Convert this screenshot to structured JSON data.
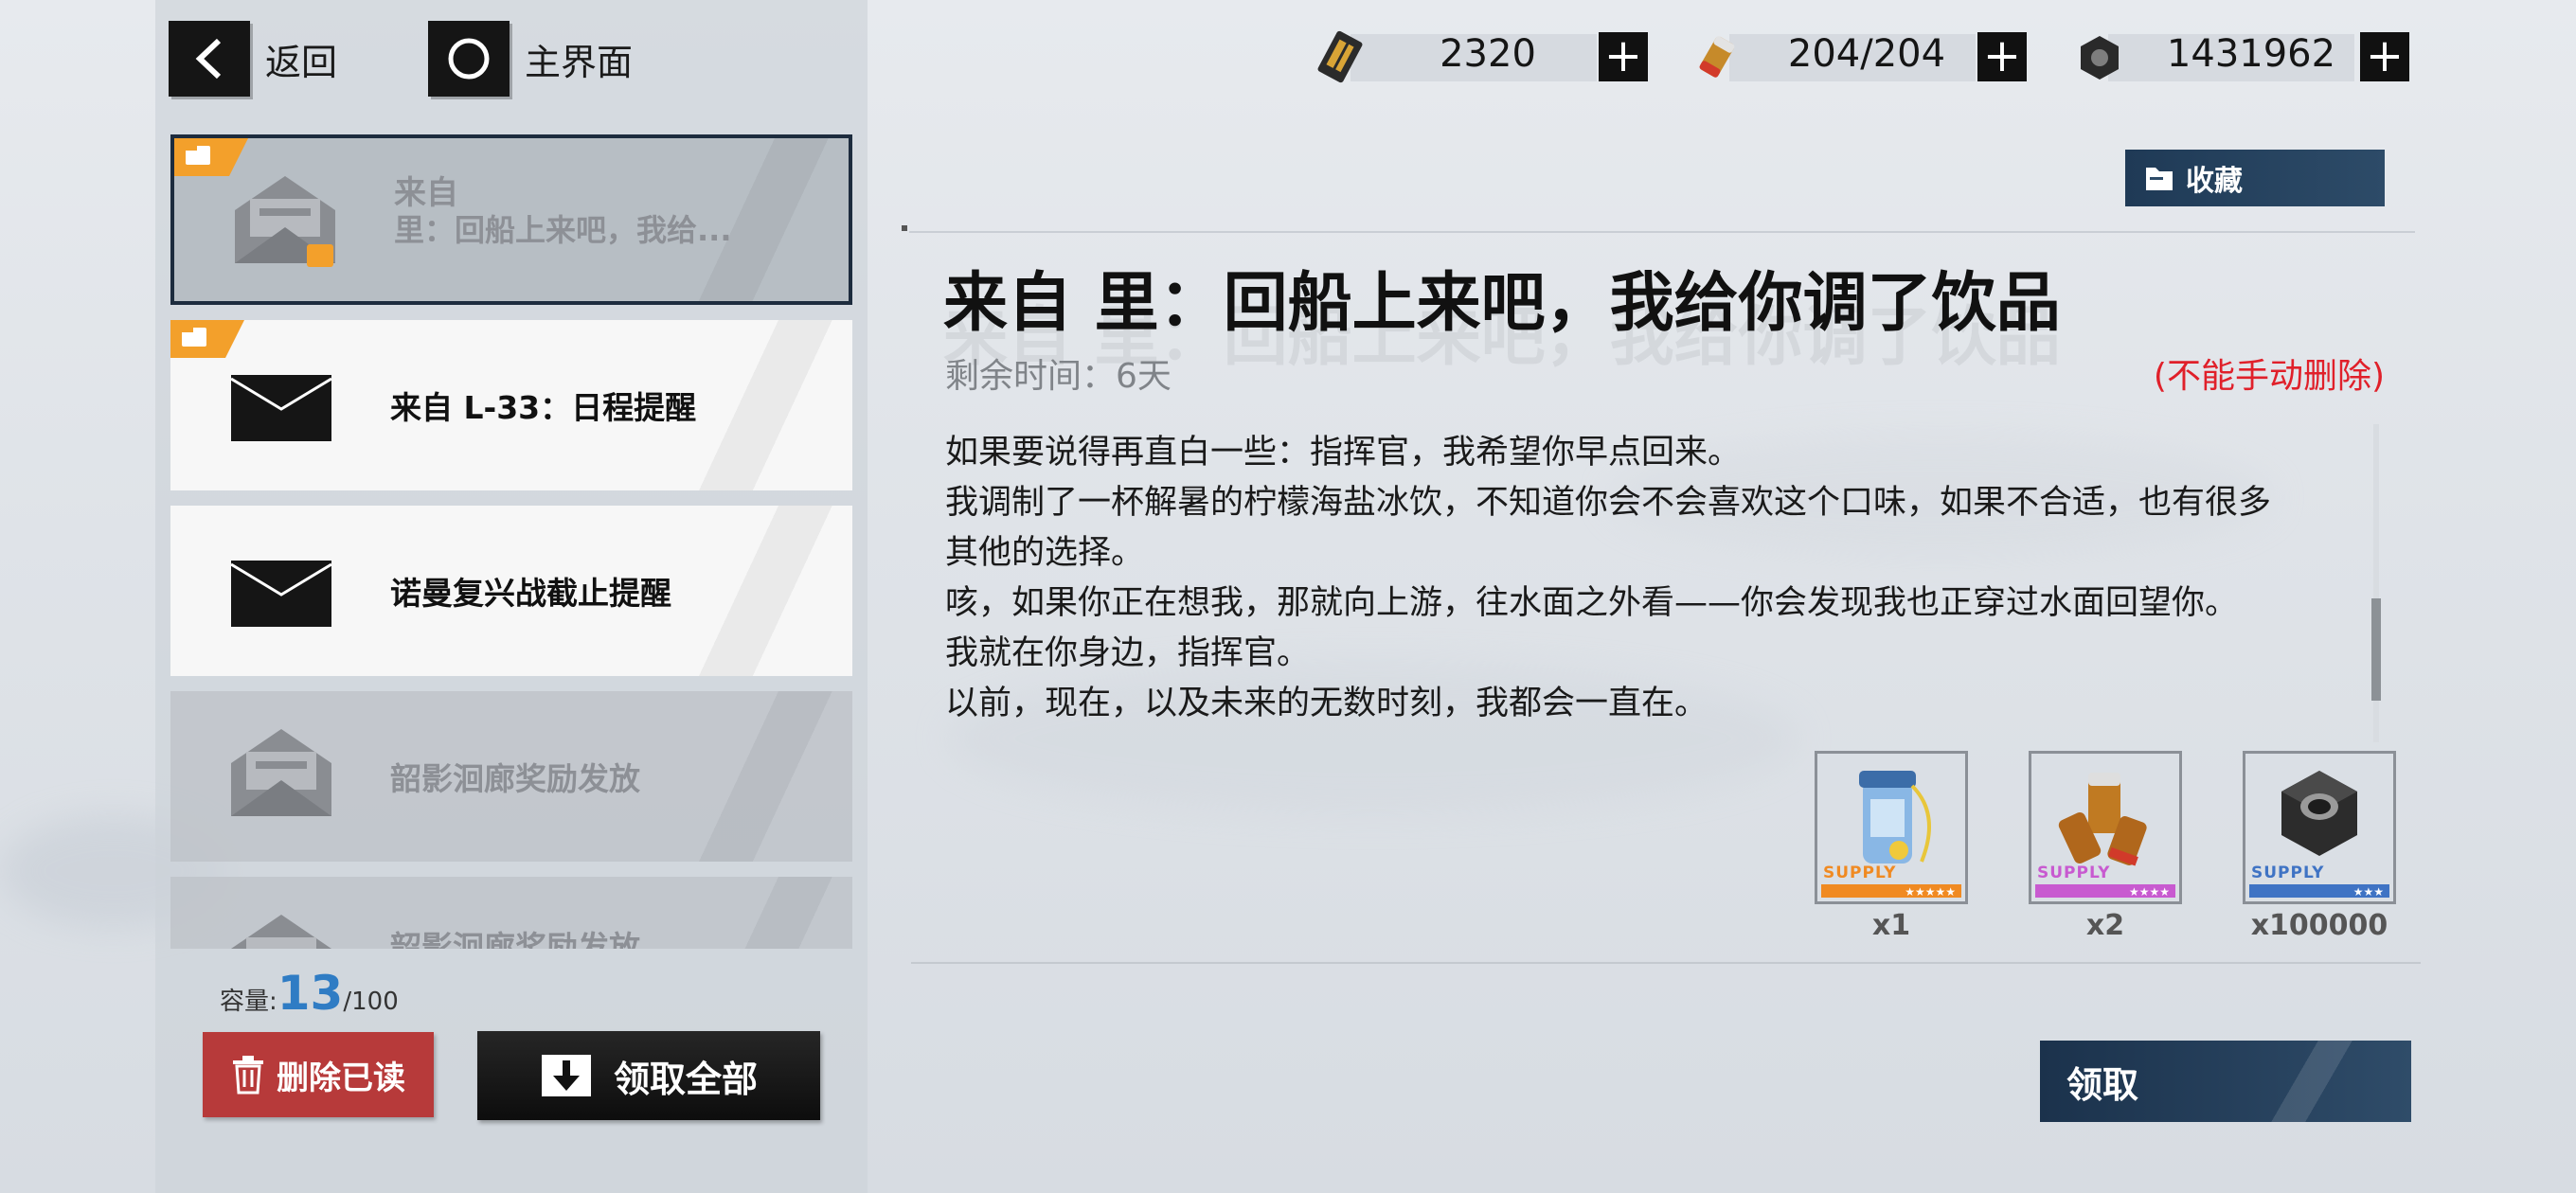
{
  "nav": {
    "back_label": "返回",
    "home_label": "主界面"
  },
  "resources": [
    {
      "icon": "ammo-voucher-icon",
      "value": "2320"
    },
    {
      "icon": "ration-battery-icon",
      "value": "204/204"
    },
    {
      "icon": "hex-nut-icon",
      "value": "1431962"
    }
  ],
  "mail_list": [
    {
      "line1": "来自",
      "line2": "里：回船上来吧，我给...",
      "state": "read",
      "selected": true,
      "flag": true,
      "attachment": true
    },
    {
      "title": "来自 L-33：日程提醒",
      "state": "unread",
      "flag": true
    },
    {
      "title": "诺曼复兴战截止提醒",
      "state": "unread",
      "flag": false
    },
    {
      "title": "韶影洄廊奖励发放",
      "state": "read",
      "flag": false
    },
    {
      "title": "韶影洄廊奖励发放",
      "state": "read",
      "flag": false
    }
  ],
  "capacity": {
    "label": "容量:",
    "current": "13",
    "max": "/100"
  },
  "buttons": {
    "delete_read": "删除已读",
    "collect_all": "领取全部",
    "favorite": "收藏",
    "claim": "领取"
  },
  "mail": {
    "title": "来自 里：回船上来吧，我给你调了饮品",
    "remaining": "剩余时间：6天",
    "no_delete": "(不能手动删除)",
    "body": [
      "如果要说得再直白一些：指挥官，我希望你早点回来。",
      "我调制了一杯解暑的柠檬海盐冰饮，不知道你会不会喜欢这个口味，如果不合适，也有很多",
      "其他的选择。",
      "咳，如果你正在想我，那就向上游，往水面之外看——你会发现我也正穿过水面回望你。",
      "我就在你身边，指挥官。",
      "以前，现在，以及未来的无数时刻，我都会一直在。"
    ],
    "rewards": [
      {
        "icon": "lemon-drink-bottle-icon",
        "supply": "SUPPLY",
        "stars": "★★★★★",
        "rarity_color": "#f08a22",
        "qty": "x1"
      },
      {
        "icon": "battery-cells-icon",
        "supply": "SUPPLY",
        "stars": "★★★★",
        "rarity_color": "#c85ad0",
        "qty": "x2"
      },
      {
        "icon": "hex-nut-icon",
        "supply": "SUPPLY",
        "stars": "★★★",
        "rarity_color": "#3f73c4",
        "qty": "x100000"
      }
    ]
  }
}
